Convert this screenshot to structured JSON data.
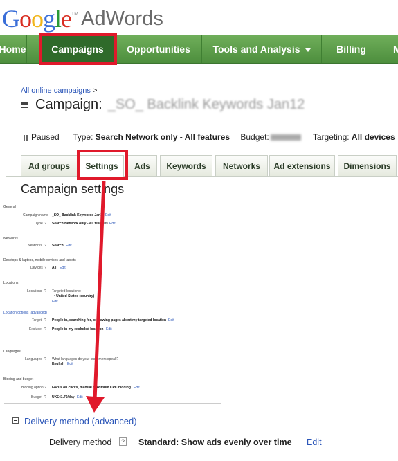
{
  "brand": {
    "google_letters": [
      "G",
      "o",
      "o",
      "g",
      "l",
      "e"
    ],
    "tm": "TM",
    "product": "AdWords"
  },
  "nav": {
    "items": [
      {
        "label": "Home"
      },
      {
        "label": "Campaigns",
        "active": true
      },
      {
        "label": "Opportunities"
      },
      {
        "label": "Tools and Analysis"
      },
      {
        "label": "Billing"
      },
      {
        "label": "M"
      }
    ]
  },
  "breadcrumb": {
    "link": "All online campaigns",
    "sep": ">"
  },
  "campaign": {
    "prefix": "Campaign:",
    "name": "_SO_ Backlink Keywords Jan12"
  },
  "status": {
    "state": "Paused",
    "type_label": "Type:",
    "type_value": "Search Network only - All features",
    "budget_label": "Budget:",
    "targeting_label": "Targeting:",
    "targeting_value": "All devices"
  },
  "tabs": [
    {
      "label": "Ad groups"
    },
    {
      "label": "Settings",
      "active": true
    },
    {
      "label": "Ads"
    },
    {
      "label": "Keywords"
    },
    {
      "label": "Networks"
    },
    {
      "label": "Ad extensions"
    },
    {
      "label": "Dimensions"
    }
  ],
  "settings_heading": "Campaign settings",
  "mini": {
    "general": "General",
    "campaign_name_label": "Campaign name",
    "campaign_name_value": "_SO_ Backlink Keywords Jan12",
    "type_label": "Type",
    "type_value": "Search Network only - All features",
    "networks": "Networks",
    "networks_label": "Networks",
    "networks_value": "Search",
    "devices_section": "Desktops & laptops, mobile devices and tablets",
    "devices_label": "Devices",
    "devices_value": "All",
    "locations": "Locations",
    "locations_label": "Locations",
    "targeted": "Targeted locations:",
    "country": "• United States (country)",
    "location_options": "Location options (advanced)",
    "target_label": "Target",
    "target_value": "People in, searching for, or viewing pages about my targeted location",
    "exclude_label": "Exclude",
    "exclude_value": "People in my excluded location",
    "languages": "Languages",
    "languages_label": "Languages",
    "languages_q": "What languages do your customers speak?",
    "languages_value": "English",
    "bidding": "Bidding and budget",
    "bidding_label": "Bidding option",
    "bidding_value": "Focus on clicks, manual maximum CPC bidding",
    "budget_label": "Budget",
    "budget_value": "UK£41.70/day",
    "edit": "Edit",
    "help": "?"
  },
  "delivery": {
    "link": "Delivery method (advanced)",
    "label": "Delivery method",
    "help": "?",
    "value": "Standard: Show ads evenly over time",
    "edit": "Edit"
  },
  "colors": {
    "nav_green": "#5a9c47",
    "highlight": "#e0192b",
    "link": "#2a55b8"
  }
}
